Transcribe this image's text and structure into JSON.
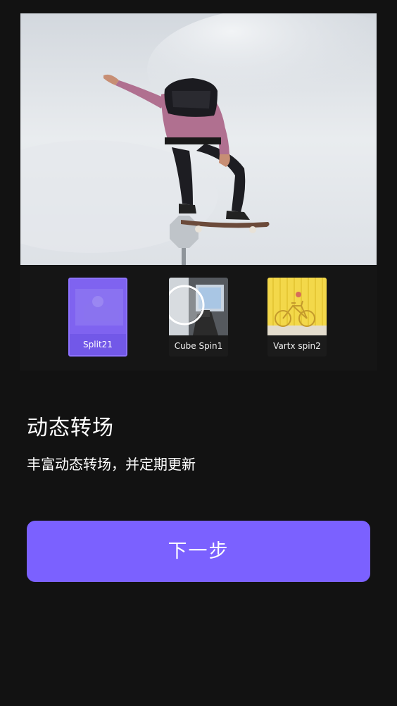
{
  "preview": {
    "image_description_icon": "skateboarder-image"
  },
  "transitions": [
    {
      "label": "Split21",
      "selected": true,
      "icon": "split-transition-thumbnail"
    },
    {
      "label": "Cube Spin1",
      "selected": false,
      "icon": "cube-spin-thumbnail"
    },
    {
      "label": "Vartx spin2",
      "selected": false,
      "icon": "bicycle-thumbnail"
    }
  ],
  "feature": {
    "title": "动态转场",
    "subtitle": "丰富动态转场，并定期更新"
  },
  "next_button": {
    "label": "下一步"
  },
  "colors": {
    "background": "#121212",
    "accent": "#7b61ff",
    "selected_thumb": "#7b5cf3"
  }
}
